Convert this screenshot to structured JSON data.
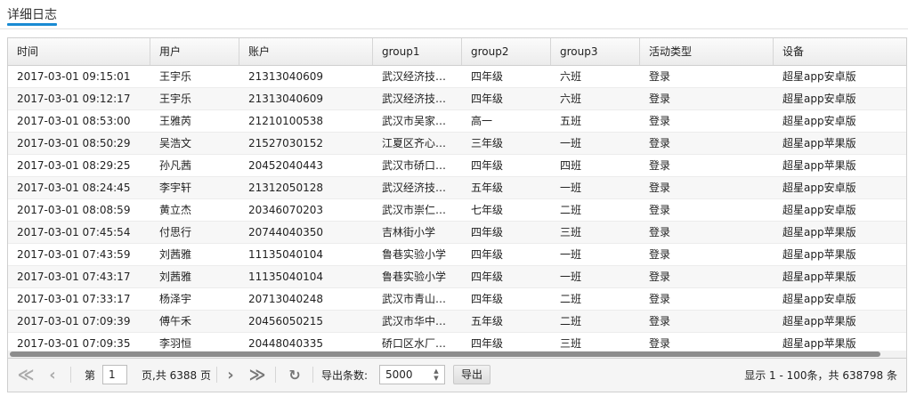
{
  "panel": {
    "title": "详细日志"
  },
  "columns": [
    "时间",
    "用户",
    "账户",
    "group1",
    "group2",
    "group3",
    "活动类型",
    "设备"
  ],
  "rows": [
    [
      "2017-03-01 09:15:01",
      "王宇乐",
      "21313040609",
      "武汉经济技…",
      "四年级",
      "六班",
      "登录",
      "超星app安卓版"
    ],
    [
      "2017-03-01 09:12:17",
      "王宇乐",
      "21313040609",
      "武汉经济技…",
      "四年级",
      "六班",
      "登录",
      "超星app安卓版"
    ],
    [
      "2017-03-01 08:53:00",
      "王雅芮",
      "21210100538",
      "武汉市吴家…",
      "高一",
      "五班",
      "登录",
      "超星app安卓版"
    ],
    [
      "2017-03-01 08:50:29",
      "吴浩文",
      "21527030152",
      "江夏区齐心…",
      "三年级",
      "一班",
      "登录",
      "超星app苹果版"
    ],
    [
      "2017-03-01 08:29:25",
      "孙凡茜",
      "20452040443",
      "武汉市硚口…",
      "四年级",
      "四班",
      "登录",
      "超星app苹果版"
    ],
    [
      "2017-03-01 08:24:45",
      "李宇轩",
      "21312050128",
      "武汉经济技…",
      "五年级",
      "一班",
      "登录",
      "超星app安卓版"
    ],
    [
      "2017-03-01 08:08:59",
      "黄立杰",
      "20346070203",
      "武汉市崇仁…",
      "七年级",
      "二班",
      "登录",
      "超星app安卓版"
    ],
    [
      "2017-03-01 07:45:54",
      "付思行",
      "20744040350",
      "吉林街小学",
      "四年级",
      "三班",
      "登录",
      "超星app苹果版"
    ],
    [
      "2017-03-01 07:43:59",
      "刘茜雅",
      "11135040104",
      "鲁巷实验小学",
      "四年级",
      "一班",
      "登录",
      "超星app苹果版"
    ],
    [
      "2017-03-01 07:43:17",
      "刘茜雅",
      "11135040104",
      "鲁巷实验小学",
      "四年级",
      "一班",
      "登录",
      "超星app苹果版"
    ],
    [
      "2017-03-01 07:33:17",
      "杨泽宇",
      "20713040248",
      "武汉市青山…",
      "四年级",
      "二班",
      "登录",
      "超星app安卓版"
    ],
    [
      "2017-03-01 07:09:39",
      "傅午禾",
      "20456050215",
      "武汉市华中…",
      "五年级",
      "二班",
      "登录",
      "超星app苹果版"
    ],
    [
      "2017-03-01 07:09:35",
      "李羽恒",
      "20448040335",
      "硚口区水厂…",
      "四年级",
      "三班",
      "登录",
      "超星app苹果版"
    ]
  ],
  "pager": {
    "page_prefix": "第",
    "page_value": "1",
    "page_suffix": "页,共 6388 页",
    "export_count_label": "导出条数:",
    "export_count_value": "5000",
    "export_button": "导出",
    "summary": "显示 1 - 100条，共 638798 条"
  }
}
